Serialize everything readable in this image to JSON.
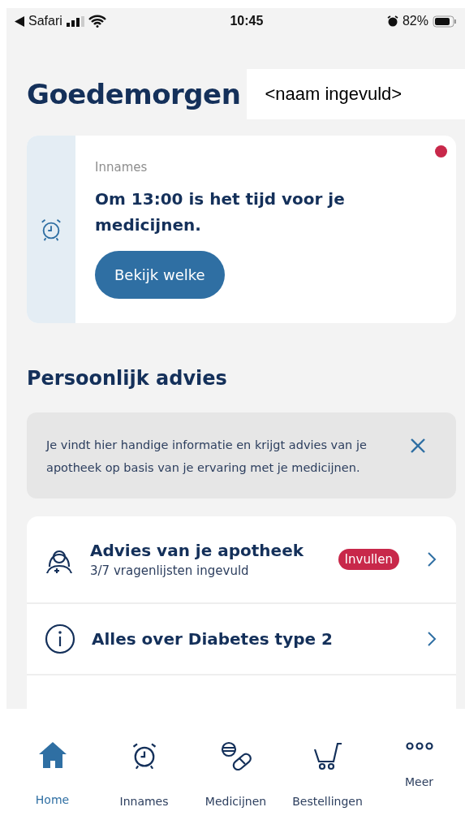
{
  "status_bar": {
    "back_app": "Safari",
    "time": "10:45",
    "battery": "82%"
  },
  "greeting": {
    "title": "Goedemorgen",
    "name": "<naam ingevuld>"
  },
  "reminder_card": {
    "label": "Innames",
    "message": "Om 13:00 is het tijd voor je medicijnen.",
    "button": "Bekijk welke",
    "unread": true
  },
  "section": {
    "title": "Persoonlijk advies"
  },
  "info_box": {
    "text": "Je vindt hier handige informatie en krijgt advies van je apotheek op basis van je ervaring met je medicijnen."
  },
  "advice_items": [
    {
      "kind": "pharmacist",
      "title": "Advies van je apotheek",
      "subtitle": "3/7 vragenlijsten ingevuld",
      "badge": "Invullen"
    },
    {
      "kind": "info",
      "title": "Alles over Diabetes type 2"
    }
  ],
  "tab_bar": [
    {
      "kind": "home",
      "label": "Home",
      "selected": true
    },
    {
      "kind": "alarm",
      "label": "Innames",
      "selected": false
    },
    {
      "kind": "pills",
      "label": "Medicijnen",
      "selected": false
    },
    {
      "kind": "cart",
      "label": "Bestellingen",
      "selected": false
    },
    {
      "kind": "more",
      "label": "Meer",
      "selected": false
    }
  ]
}
